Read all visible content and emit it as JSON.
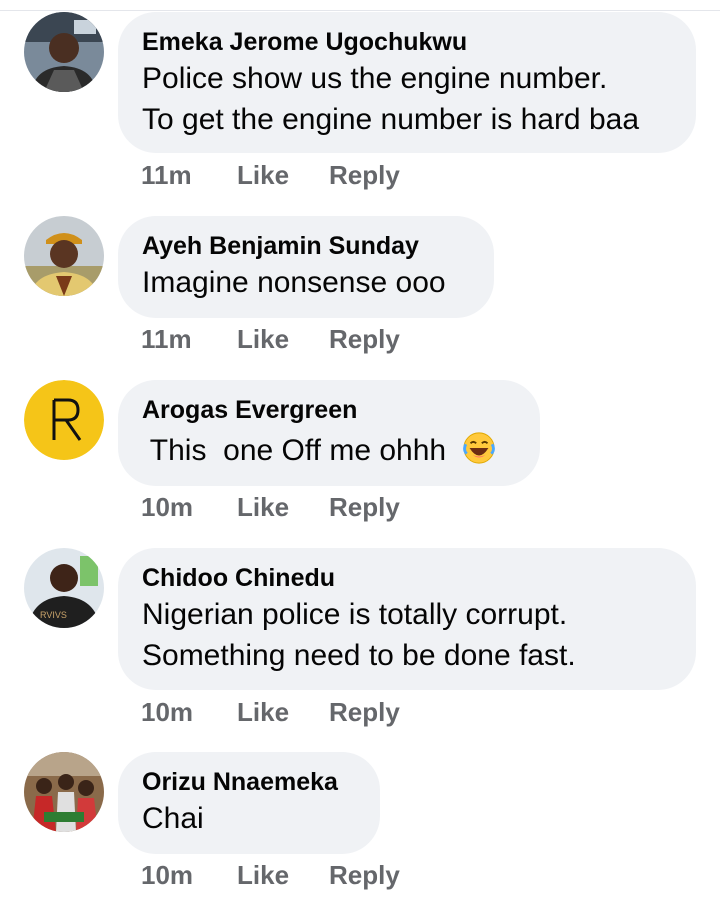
{
  "comments": [
    {
      "author": "Emeka Jerome Ugochukwu",
      "text": "Police show us the engine number.\nTo get the engine number is hard baa",
      "time": "11m",
      "like": "Like",
      "reply": "Reply",
      "avatar": "profile-photo-man"
    },
    {
      "author": "Ayeh Benjamin Sunday",
      "text": "Imagine nonsense ooo",
      "time": "11m",
      "like": "Like",
      "reply": "Reply",
      "avatar": "profile-photo-man-cap"
    },
    {
      "author": "Arogas Evergreen",
      "text": " This  one Off me ohhh ",
      "time": "10m",
      "like": "Like",
      "reply": "Reply",
      "avatar": "realme-logo",
      "emoji": "laughing-tears-emoji"
    },
    {
      "author": "Chidoo Chinedu",
      "text": "Nigerian police is totally corrupt.\nSomething need to be done fast.",
      "time": "10m",
      "like": "Like",
      "reply": "Reply",
      "avatar": "profile-photo-man-dark-shirt"
    },
    {
      "author": "Orizu Nnaemeka",
      "text": "Chai",
      "time": "10m",
      "like": "Like",
      "reply": "Reply",
      "avatar": "profile-photo-group"
    }
  ],
  "colors": {
    "bubble": "#f0f2f5",
    "meta": "#65676b",
    "text": "#050505",
    "logo_bg": "#f5c518"
  }
}
